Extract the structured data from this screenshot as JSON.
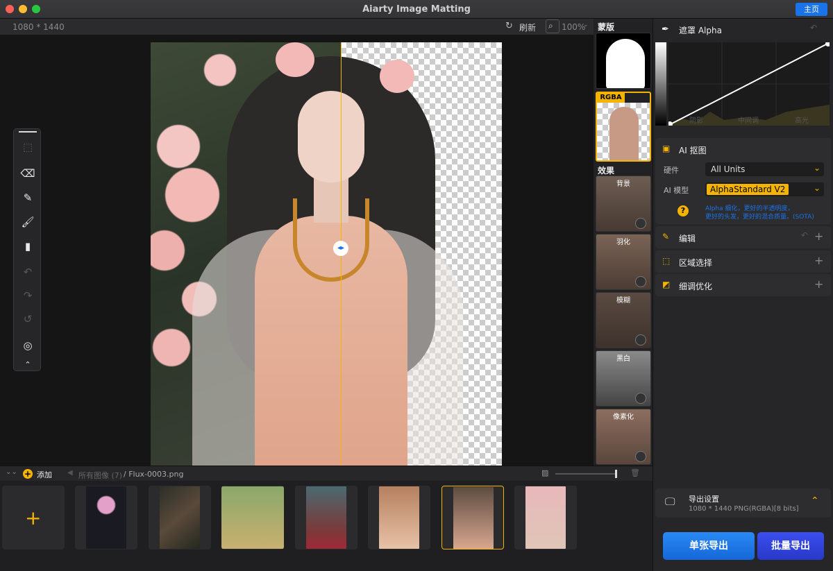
{
  "window": {
    "title": "Aiarty Image Matting",
    "home_label": "主页"
  },
  "toolbar": {
    "dimensions": "1080 * 1440",
    "refresh_label": "刷新",
    "zoom": "100%"
  },
  "thumbnails": {
    "mask_label": "蒙版",
    "rgba_badge": "RGBA",
    "effects_label": "效果",
    "effects": [
      "背景",
      "羽化",
      "模糊",
      "黑白",
      "像素化"
    ]
  },
  "right_panel": {
    "alpha": {
      "title": "遮罩 Alpha",
      "labels": [
        "阴影",
        "中间调",
        "高光"
      ]
    },
    "ai_matting": {
      "title": "AI 抠图",
      "hardware_label": "硬件",
      "hardware_value": "All Units",
      "model_label": "AI 模型",
      "model_value": "AlphaStandard  V2",
      "note_line1": "Alpha 细化，更好的半透明度，",
      "note_line2": "更好的头发，更好的混合质量。(SOTA)"
    },
    "edit": {
      "title": "编辑"
    },
    "region": {
      "title": "区域选择"
    },
    "refine": {
      "title": "细调优化"
    },
    "export": {
      "title": "导出设置",
      "detail": "1080 * 1440 PNG(RGBA)[8 bits]",
      "single": "单张导出",
      "batch": "批量导出"
    }
  },
  "bottom": {
    "add_label": "添加",
    "breadcrumb_all": "所有图像 (7)",
    "breadcrumb_file": "/ Flux-0003.png"
  },
  "colors": {
    "accent": "#f5b400",
    "blue": "#1a73e8"
  },
  "icons": [
    "eraser-icon",
    "brush-icon",
    "paint-brush-icon",
    "roller-icon",
    "undo-icon",
    "redo-icon",
    "reset-icon",
    "select-icon",
    "collapse-icon",
    "search-icon",
    "help-icon"
  ]
}
